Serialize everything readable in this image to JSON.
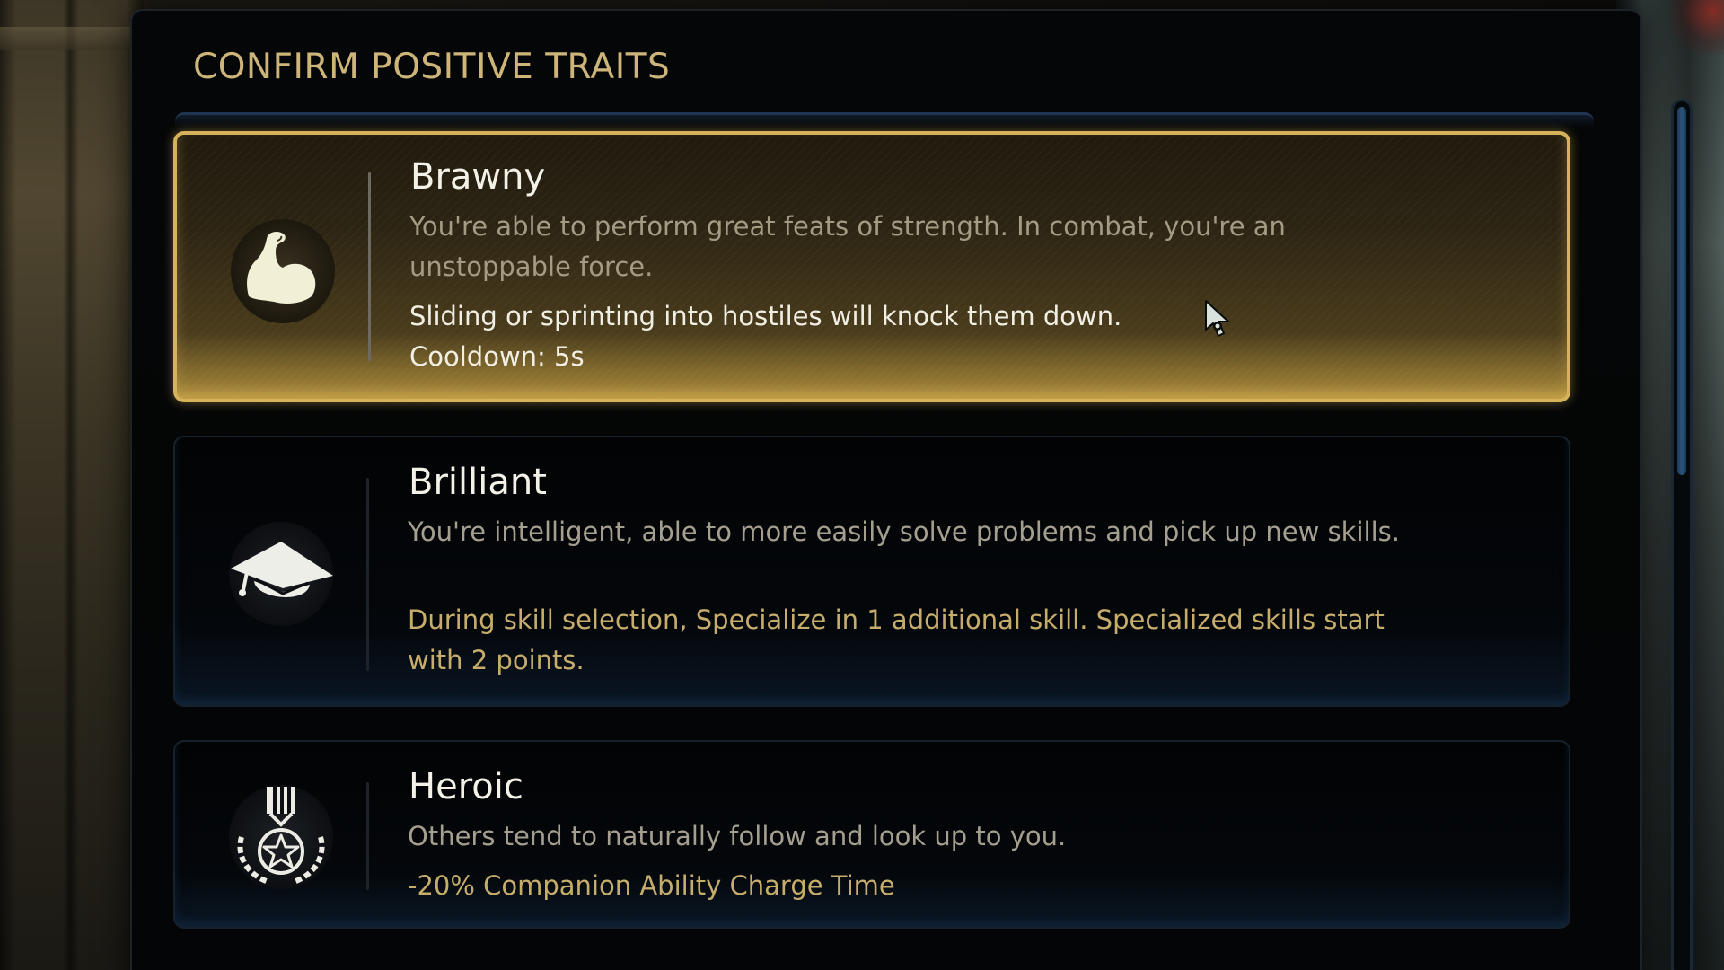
{
  "header": {
    "title": "CONFIRM POSITIVE TRAITS"
  },
  "traits": [
    {
      "name": "Brawny",
      "description": "You're able to perform great feats of strength. In combat, you're an unstoppable force.",
      "effect_line1": "Sliding or sprinting into hostiles will knock them down.",
      "effect_line2": "Cooldown: 5s",
      "icon": "flexed-bicep-icon",
      "selected": true
    },
    {
      "name": "Brilliant",
      "description": "You're intelligent, able to more easily solve problems and pick up new skills.",
      "effect": "During skill selection, Specialize in 1 additional skill. Specialized skills start with 2 points.",
      "icon": "graduation-cap-icon",
      "selected": false
    },
    {
      "name": "Heroic",
      "description": "Others tend to naturally follow and look up to you.",
      "effect": "-20% Companion Ability Charge Time",
      "icon": "medal-star-icon",
      "selected": false
    }
  ],
  "colors": {
    "accent_gold": "#d6b35a",
    "title_gold": "#cdb57a",
    "effect_gold": "#c7ad6b",
    "panel_bg": "#050607",
    "scrollbar_blue": "#2b5478"
  }
}
